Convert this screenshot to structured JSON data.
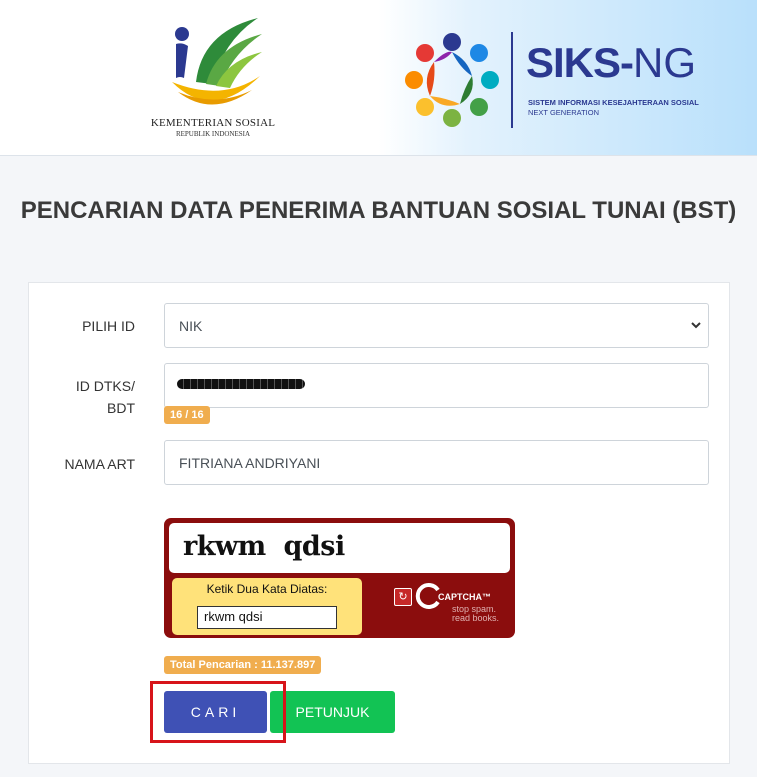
{
  "header": {
    "kemensos_name": "KEMENTERIAN SOSIAL",
    "kemensos_sub": "REPUBLIK INDONESIA",
    "siks_brand_a": "SIKS-",
    "siks_brand_b": "NG",
    "siks_tagline": "SISTEM INFORMASI KESEJAHTERAAN SOSIAL",
    "siks_tagline2": "NEXT GENERATION"
  },
  "title": "PENCARIAN DATA PENERIMA BANTUAN SOSIAL TUNAI (BST)",
  "form": {
    "pilih_id_label": "PILIH ID",
    "pilih_id_value": "NIK",
    "id_label_line1": "ID DTKS/",
    "id_label_line2": "BDT",
    "id_counter": "16 / 16",
    "nama_label": "NAMA ART",
    "nama_value": "FITRIANA ANDRIYANI"
  },
  "captcha": {
    "words": "rkwm  qdsi",
    "instruction": "Ketik Dua Kata Diatas:",
    "input_value": "rkwm qdsi",
    "logo_text": "CAPTCHA™",
    "slogan1": "stop spam.",
    "slogan2": "read books."
  },
  "total_pencarian": "Total Pencarian : 11.137.897",
  "buttons": {
    "cari": "CARI",
    "petunjuk": "PETUNJUK"
  },
  "colors": {
    "primary": "#3f51b5",
    "success": "#12c354",
    "warning": "#f0ad4e",
    "captcha_bg": "#8b0d0d",
    "highlight": "#d7141a"
  },
  "icons": {
    "select": "chevron-down-icon",
    "captcha_reload": "reload-icon"
  }
}
